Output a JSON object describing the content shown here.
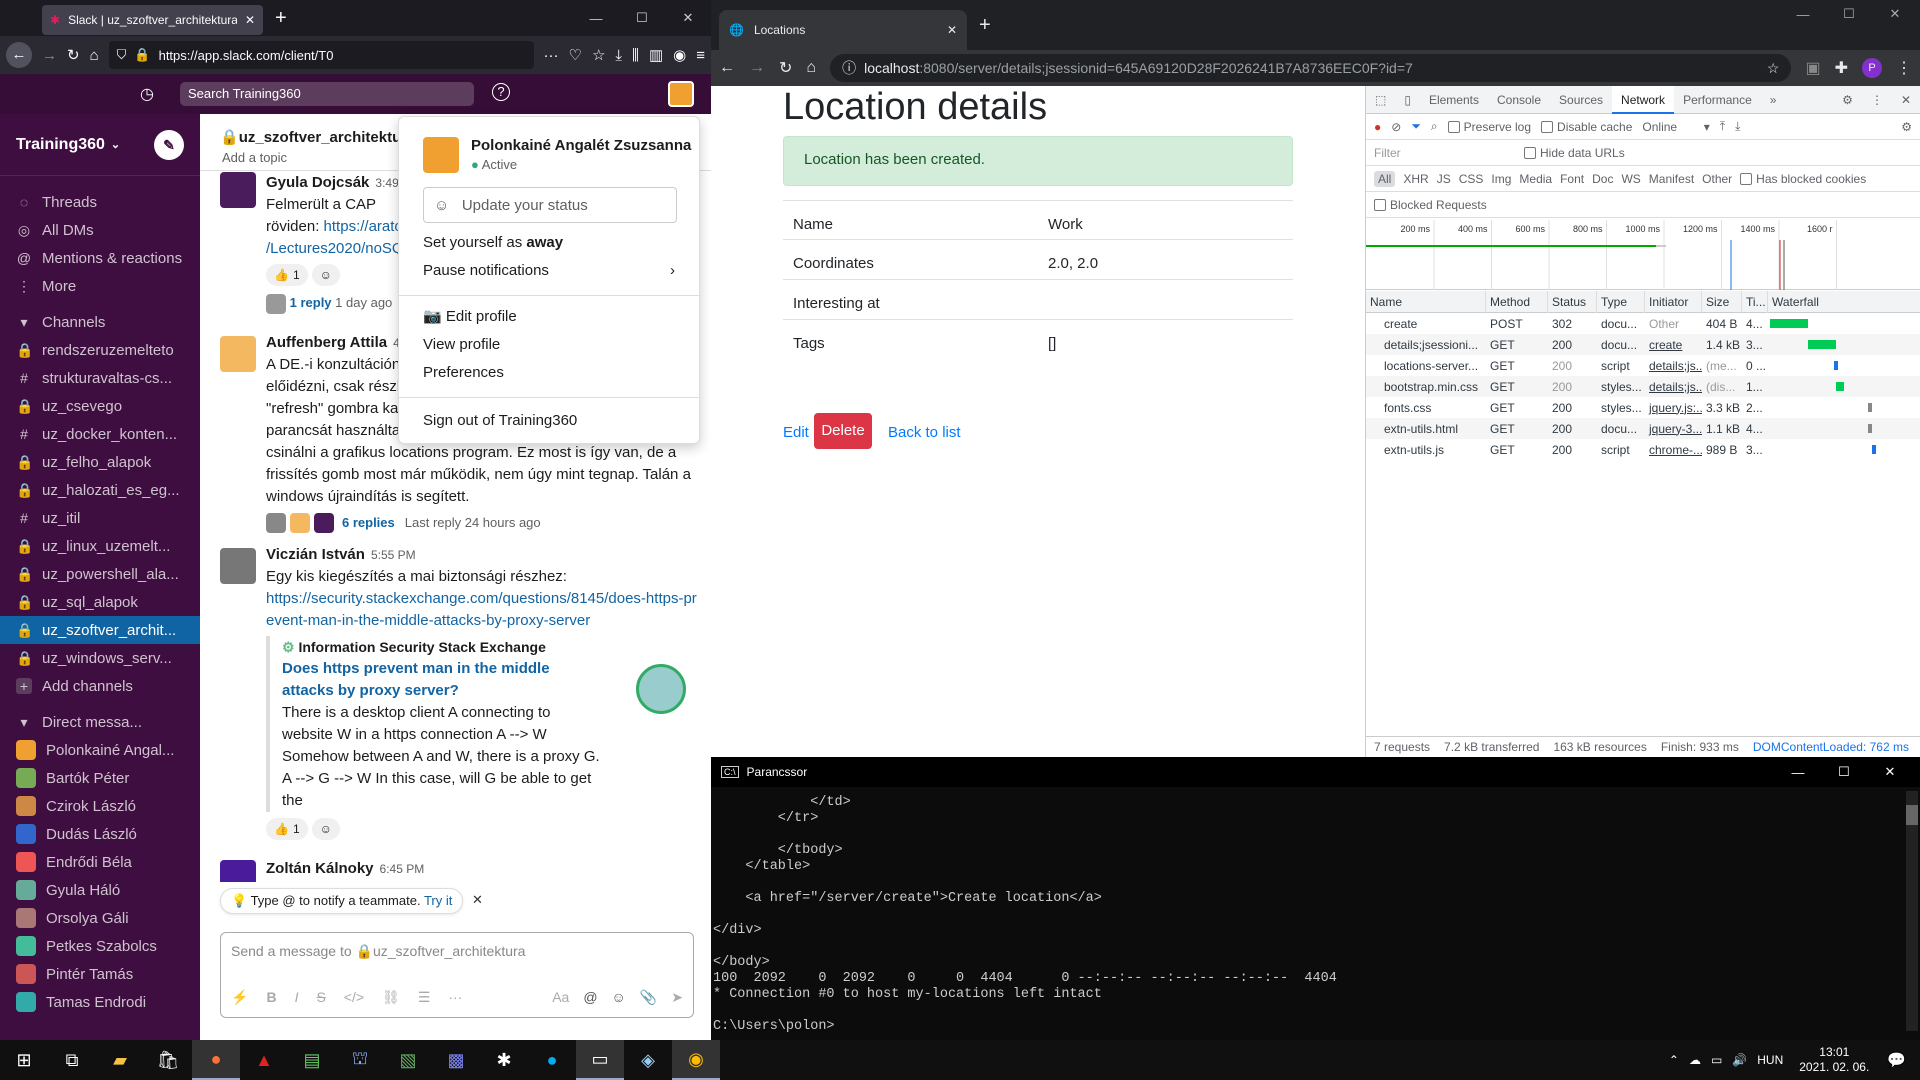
{
  "firefox": {
    "tab_title": "Slack | uz_szoftver_architektura",
    "url": "https://app.slack.com/client/T0"
  },
  "slack": {
    "search_placeholder": "Search Training360",
    "workspace": "Training360",
    "channel_title": "uz_szoftver_architektura",
    "add_topic": "Add a topic",
    "nav": [
      "Threads",
      "All DMs",
      "Mentions & reactions",
      "More"
    ],
    "channels_header": "Channels",
    "channels": [
      {
        "prefix": "lock",
        "name": "rendszeruzemelteto"
      },
      {
        "prefix": "#",
        "name": "strukturavaltas-cs..."
      },
      {
        "prefix": "lock",
        "name": "uz_csevego"
      },
      {
        "prefix": "#",
        "name": "uz_docker_konten..."
      },
      {
        "prefix": "lock",
        "name": "uz_felho_alapok"
      },
      {
        "prefix": "lock",
        "name": "uz_halozati_es_eg..."
      },
      {
        "prefix": "#",
        "name": "uz_itil"
      },
      {
        "prefix": "lock",
        "name": "uz_linux_uzemelt..."
      },
      {
        "prefix": "lock",
        "name": "uz_powershell_ala..."
      },
      {
        "prefix": "lock",
        "name": "uz_sql_alapok"
      },
      {
        "prefix": "lock",
        "name": "uz_szoftver_archit..."
      },
      {
        "prefix": "lock",
        "name": "uz_windows_serv..."
      }
    ],
    "add_channels": "Add channels",
    "dm_header": "Direct messa...",
    "dms": [
      "Polonkainé Angal...",
      "Bartók Péter",
      "Czirok László",
      "Dudás László",
      "Endrődi Béla",
      "Gyula Háló",
      "Orsolya Gáli",
      "Petkes Szabolcs",
      "Pintér Tamás",
      "Tamas Endrodi"
    ],
    "messages": {
      "m1": {
        "name": "Gyula Dojcsák",
        "time": "3:49",
        "line1": "Felmerült a CAP",
        "line2": "röviden: ",
        "link1": "https://arato",
        "link2": "/Lectures2020/noSQ",
        "react_count": "1",
        "reply_label": "1 reply",
        "reply_time": "1 day ago"
      },
      "m2": {
        "name": "Auffenberg Attila",
        "time": "4:",
        "lines": [
          "A DE.-i konzultáción",
          "előidézni, csak részb",
          "\"refresh\" gombra kat",
          "parancsát használtam",
          "csinálni a grafikus locations program. Ez most is így van, de a",
          "frissítés gomb most már működik, nem úgy mint tegnap. Talán a",
          "windows újraindítás is segített."
        ],
        "replies": "6 replies",
        "last_reply": "Last reply 24 hours ago"
      },
      "m3": {
        "name": "Viczián István",
        "time": "5:55 PM",
        "text": "Egy kis kiegészítés a mai biztonsági részhez:",
        "link": "https://security.stackexchange.com/questions/8145/does-https-prevent-man-in-the-middle-attacks-by-proxy-server",
        "unfurl_site": "Information Security Stack Exchange",
        "unfurl_title": "Does https prevent man in the middle attacks by proxy server?",
        "unfurl_desc": "There is a desktop client A connecting to website W in a https connection A --> W Somehow between A and W, there is a proxy G. A --> G --> W In this case, will G be able to get the",
        "react_count": "1"
      },
      "m4": {
        "name": "Zoltán Kálnoky",
        "time": "6:45 PM"
      }
    },
    "tip_text": "Type @ to notify a teammate.",
    "tip_link": "Try it",
    "composer_placeholder": "Send a message to 🔒uz_szoftver_architektura",
    "popup": {
      "name": "Polonkainé Angalét Zsuzsanna",
      "status": "Active",
      "update_status": "Update your status",
      "set_away_pre": "Set yourself as ",
      "set_away_bold": "away",
      "pause": "Pause notifications",
      "edit_profile": "Edit profile",
      "view_profile": "View profile",
      "preferences": "Preferences",
      "sign_out": "Sign out of Training360"
    }
  },
  "chrome": {
    "tab_title": "Locations",
    "url_host": "localhost",
    "url_rest": ":8080/server/details;jsessionid=645A69120D28F2026241B7A8736EEC0F?id=7"
  },
  "page": {
    "title": "Location details",
    "alert": "Location has been created.",
    "rows": [
      {
        "label": "Name",
        "value": "Work"
      },
      {
        "label": "Coordinates",
        "value": "2.0, 2.0"
      },
      {
        "label": "Interesting at",
        "value": ""
      },
      {
        "label": "Tags",
        "value": "[]"
      }
    ],
    "edit": "Edit",
    "delete": "Delete",
    "back": "Back to list"
  },
  "devtools": {
    "tabs": [
      "Elements",
      "Console",
      "Sources",
      "Network",
      "Performance"
    ],
    "preserve_log": "Preserve log",
    "disable_cache": "Disable cache",
    "throttle": "Online",
    "filter": "Filter",
    "hide_data_urls": "Hide data URLs",
    "types": [
      "All",
      "XHR",
      "JS",
      "CSS",
      "Img",
      "Media",
      "Font",
      "Doc",
      "WS",
      "Manifest",
      "Other"
    ],
    "blocked_cookies": "Has blocked cookies",
    "blocked_requests": "Blocked Requests",
    "ticks": [
      "200 ms",
      "400 ms",
      "600 ms",
      "800 ms",
      "1000 ms",
      "1200 ms",
      "1400 ms",
      "1600 r"
    ],
    "columns": [
      "Name",
      "Method",
      "Status",
      "Type",
      "Initiator",
      "Size",
      "Ti...",
      "Waterfall"
    ],
    "rows": [
      {
        "name": "create",
        "method": "POST",
        "status": "302",
        "type": "docu...",
        "initiator": "Other",
        "size": "404 B",
        "time": "4..."
      },
      {
        "name": "details;jsessioni...",
        "method": "GET",
        "status": "200",
        "type": "docu...",
        "initiator": "create",
        "size": "1.4 kB",
        "time": "3..."
      },
      {
        "name": "locations-server...",
        "method": "GET",
        "status": "200",
        "type": "script",
        "initiator": "details;js...",
        "size": "(me...",
        "time": "0 ..."
      },
      {
        "name": "bootstrap.min.css",
        "method": "GET",
        "status": "200",
        "type": "styles...",
        "initiator": "details;js...",
        "size": "(dis...",
        "time": "1..."
      },
      {
        "name": "fonts.css",
        "method": "GET",
        "status": "200",
        "type": "styles...",
        "initiator": "jquery.js:...",
        "size": "3.3 kB",
        "time": "2..."
      },
      {
        "name": "extn-utils.html",
        "method": "GET",
        "status": "200",
        "type": "docu...",
        "initiator": "jquery-3....",
        "size": "1.1 kB",
        "time": "4..."
      },
      {
        "name": "extn-utils.js",
        "method": "GET",
        "status": "200",
        "type": "script",
        "initiator": "chrome-...",
        "size": "989 B",
        "time": "3..."
      }
    ],
    "status_bar": [
      "7 requests",
      "7.2 kB transferred",
      "163 kB resources",
      "Finish: 933 ms",
      "DOMContentLoaded: 762 ms"
    ]
  },
  "cmd": {
    "title": "Parancssor",
    "output": "            </td>\n        </tr>\n\n        </tbody>\n    </table>\n\n    <a href=\"/server/create\">Create location</a>\n\n</div>\n\n</body>\n100  2092    0  2092    0     0  4404      0 --:--:-- --:--:-- --:--:--  4404\n* Connection #0 to host my-locations left intact\n\nC:\\Users\\polon>"
  },
  "taskbar": {
    "lang": "HUN",
    "time": "13:01",
    "date": "2021. 02. 06."
  }
}
